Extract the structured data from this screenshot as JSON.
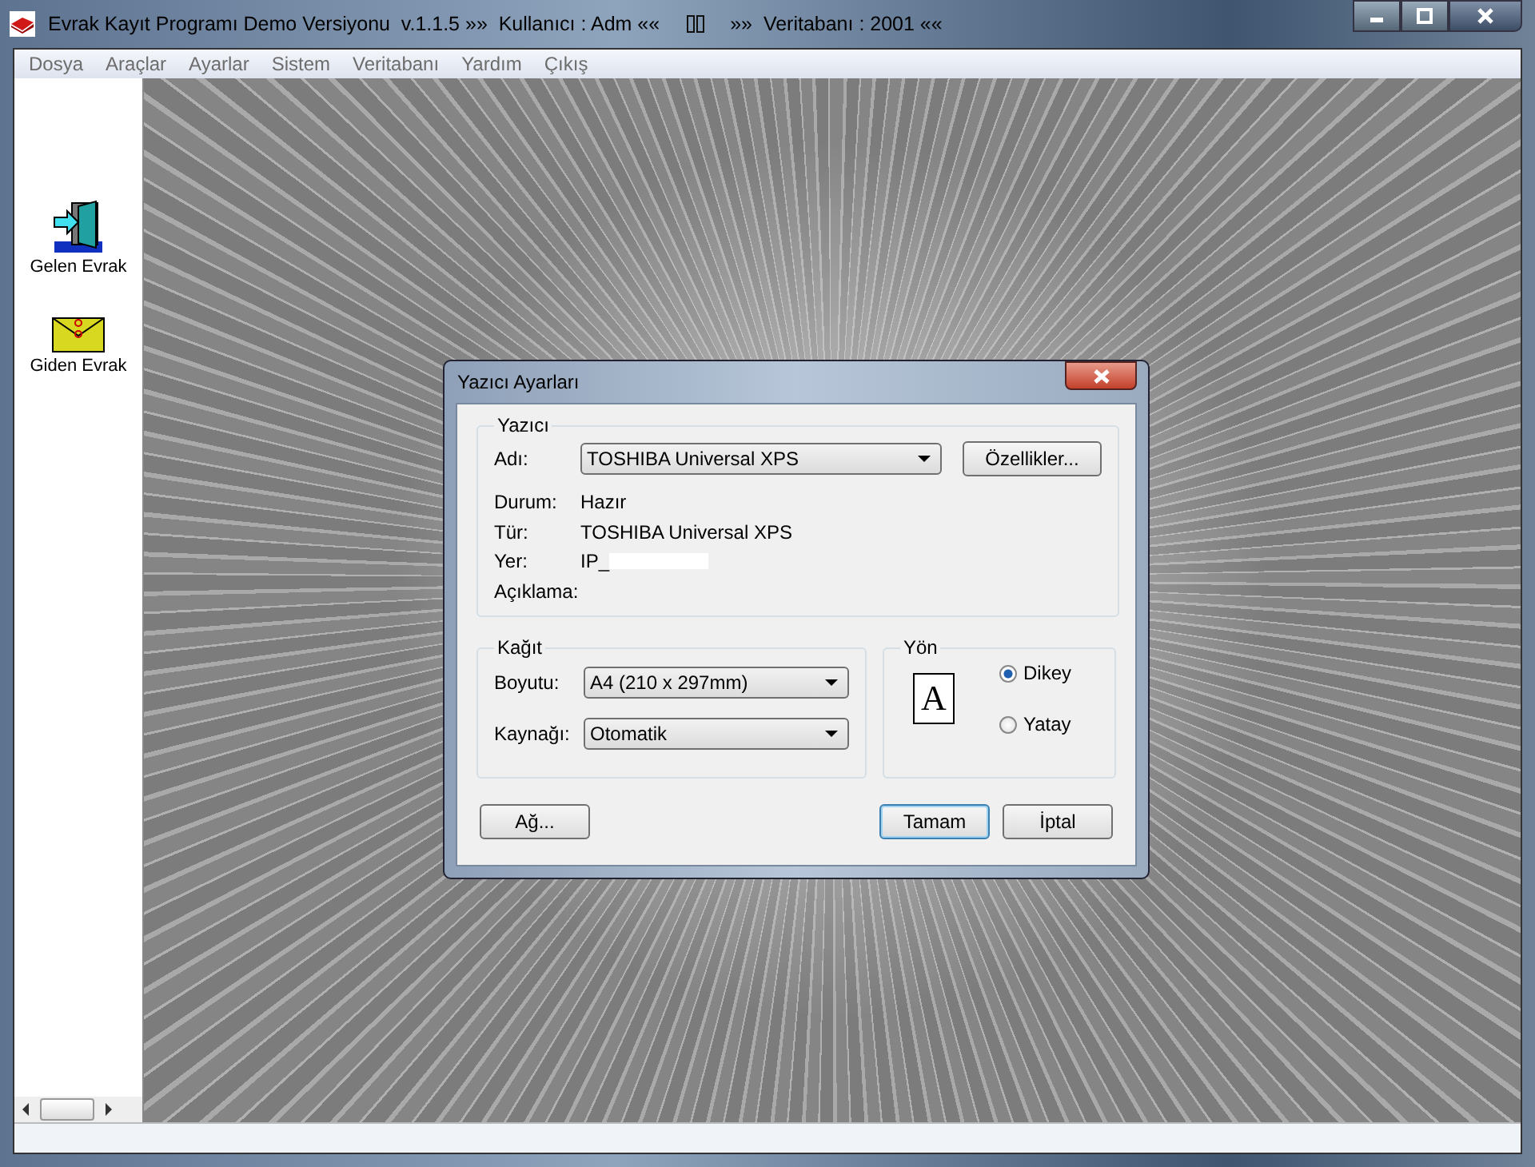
{
  "window": {
    "title": "Evrak Kayıt Programı Demo Versiyonu  v.1.1.5 »»  Kullanıcı : Adm ««",
    "title_suffix": "»»  Veritabanı : 2001 ««"
  },
  "menu": [
    "Dosya",
    "Araçlar",
    "Ayarlar",
    "Sistem",
    "Veritabanı",
    "Yardım",
    "Çıkış"
  ],
  "sidebar": {
    "items": [
      {
        "label": "Gelen Evrak",
        "kind": "incoming"
      },
      {
        "label": "Giden Evrak",
        "kind": "outgoing"
      }
    ]
  },
  "dialog": {
    "title": "Yazıcı Ayarları",
    "printer": {
      "title": "Yazıcı",
      "name_label": "Adı:",
      "name_value": "TOSHIBA Universal XPS",
      "properties_button": "Özellikler...",
      "details": [
        {
          "label": "Durum:",
          "value": "Hazır",
          "redacted": false
        },
        {
          "label": "Tür:",
          "value": "TOSHIBA Universal XPS",
          "redacted": false
        },
        {
          "label": "Yer:",
          "value": "IP_",
          "redacted": true
        },
        {
          "label": "Açıklama:",
          "redacted": false
        }
      ]
    },
    "paper": {
      "title": "Kağıt",
      "fields": [
        {
          "label": "Boyutu:",
          "value": "A4 (210 x 297mm)"
        },
        {
          "label": "Kaynağı:",
          "value": "Otomatik"
        }
      ]
    },
    "orientation": {
      "title": "Yön",
      "preview_glyph": "A",
      "options": [
        {
          "label": "Dikey",
          "selected": true
        },
        {
          "label": "Yatay",
          "selected": false
        }
      ]
    },
    "buttons": [
      {
        "label": "Ağ...",
        "default": false
      },
      {
        "label": "Tamam",
        "default": true
      },
      {
        "label": "İptal",
        "default": false
      }
    ]
  }
}
